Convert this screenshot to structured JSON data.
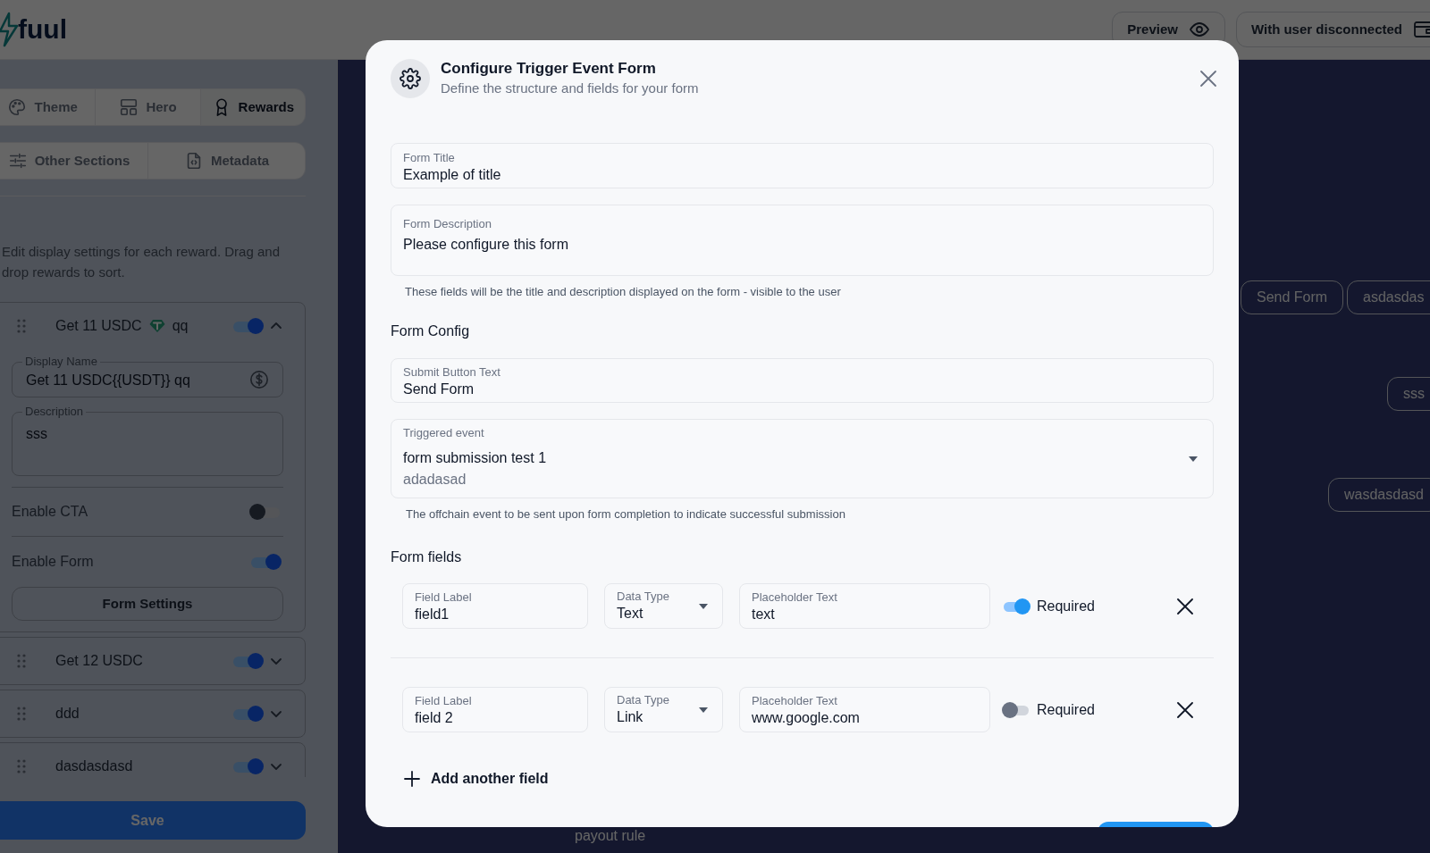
{
  "header": {
    "logo": "fuul",
    "buttons": [
      {
        "label": "Preview"
      },
      {
        "label": "With user disconnected"
      }
    ]
  },
  "sidebar": {
    "tab_rows": [
      [
        {
          "label": "Theme",
          "selected": false
        },
        {
          "label": "Hero",
          "selected": false
        },
        {
          "label": "Rewards",
          "selected": true
        }
      ],
      [
        {
          "label": "Other Sections",
          "selected": false
        },
        {
          "label": "Metadata",
          "selected": false
        }
      ]
    ],
    "description": "Edit display settings for each reward. Drag and drop rewards to sort.",
    "rewards": [
      {
        "title": "Get 11 USDC",
        "title_suffix": "qq",
        "on": true,
        "expanded": true,
        "display_name": {
          "label": "Display Name",
          "value": "Get 11 USDC{{USDT}} qq"
        },
        "description": {
          "label": "Description",
          "value": "sss"
        },
        "toggles": [
          {
            "label": "Enable CTA",
            "on": false
          },
          {
            "label": "Enable Form",
            "on": true
          }
        ],
        "form_settings_button": "Form Settings"
      },
      {
        "title": "Get 12 USDC",
        "on": true,
        "expanded": false
      },
      {
        "title": "ddd",
        "on": true,
        "expanded": false
      },
      {
        "title": "dasdasdasd",
        "on": true,
        "expanded": false
      }
    ],
    "save_button": "Save"
  },
  "preview": {
    "chips": [
      {
        "label": "Send Form"
      },
      {
        "label": "asdasdas"
      },
      {
        "label": "sss"
      },
      {
        "label": "wasdasdasd"
      }
    ],
    "caption": "payout rule"
  },
  "modal": {
    "title": "Configure Trigger Event Form",
    "subtitle": "Define the structure and fields for your form",
    "form_title": {
      "label": "Form Title",
      "value": "Example of title"
    },
    "form_description": {
      "label": "Form Description",
      "value": "Please configure this form"
    },
    "details_hint": "These fields will be the title and description displayed on the form - visible to the user",
    "config_heading": "Form Config",
    "submit_button_text": {
      "label": "Submit Button Text",
      "value": "Send Form"
    },
    "triggered_event": {
      "label": "Triggered event",
      "value": "form submission test 1",
      "secondary": "adadasad"
    },
    "event_hint": "The offchain event to be sent upon form completion to indicate successful submission",
    "fields_heading": "Form fields",
    "fields": [
      {
        "label": {
          "label": "Field Label",
          "value": "field1"
        },
        "data_type": {
          "label": "Data Type",
          "value": "Text"
        },
        "placeholder_text": {
          "label": "Placeholder Text",
          "value": "text"
        },
        "required_label": "Required",
        "required": true
      },
      {
        "label": {
          "label": "Field Label",
          "value": "field 2"
        },
        "data_type": {
          "label": "Data Type",
          "value": "Link"
        },
        "placeholder_text": {
          "label": "Placeholder Text",
          "value": "www.google.com"
        },
        "required_label": "Required",
        "required": false
      }
    ],
    "add_field_button": "Add another field"
  }
}
